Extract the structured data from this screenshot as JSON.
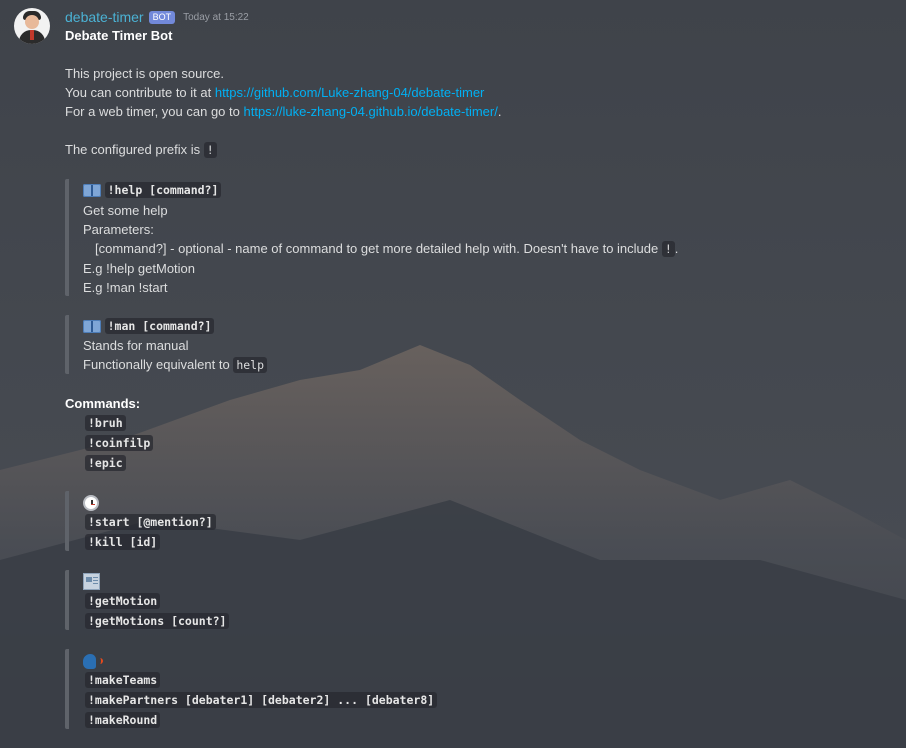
{
  "message": {
    "username": "debate-timer",
    "bot_tag": "BOT",
    "timestamp": "Today at 15:22",
    "title": "Debate Timer Bot",
    "intro": {
      "line1": "This project is open source.",
      "line2_prefix": "You can contribute to it at ",
      "repo_url": "https://github.com/Luke-zhang-04/debate-timer",
      "line3_prefix": "For a web timer, you can go to ",
      "web_url": "https://luke-zhang-04.github.io/debate-timer/",
      "line3_suffix": "."
    },
    "prefix": {
      "text": "The configured prefix is ",
      "value": "!"
    },
    "help_block": {
      "icon": "book-icon",
      "command": "!help [command?]",
      "description": "Get some help",
      "params_label": "Parameters:",
      "param_text": "[command?] - optional - name of command to get more detailed help with. Doesn't have to include ",
      "param_code": "!",
      "param_suffix": ".",
      "example1": "E.g !help getMotion",
      "example2": "E.g !man !start"
    },
    "man_block": {
      "icon": "book-icon",
      "command": "!man [command?]",
      "description": "Stands for manual",
      "equiv_text": "Functionally equivalent to ",
      "equiv_code": "help"
    },
    "commands_label": "Commands:",
    "misc_commands": [
      "!bruh",
      "!coinfilp",
      "!epic"
    ],
    "timer_block": {
      "icon": "stopwatch-icon",
      "commands": [
        "!start [@mention?]",
        "!kill [id]"
      ]
    },
    "motion_block": {
      "icon": "newspaper-icon",
      "commands": [
        "!getMotion",
        "!getMotions [count?]"
      ]
    },
    "teams_block": {
      "icon": "speaking-head-icon",
      "commands": [
        "!makeTeams",
        "!makePartners [debater1] [debater2] ... [debater8]",
        "!makeRound"
      ]
    }
  }
}
